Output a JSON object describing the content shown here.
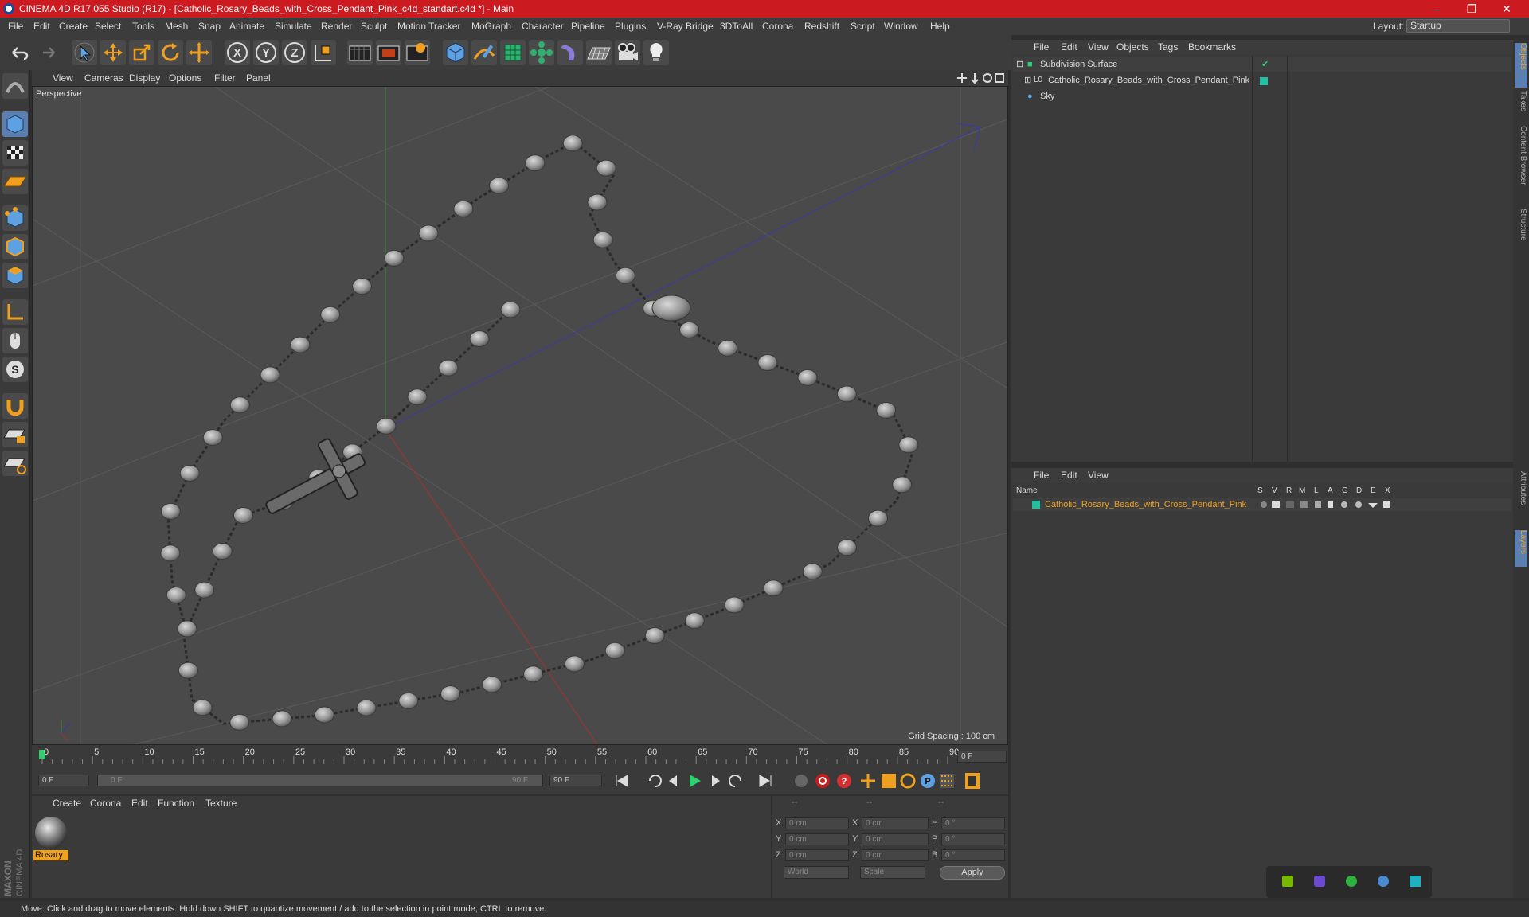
{
  "window": {
    "title": "CINEMA 4D R17.055 Studio (R17) - [Catholic_Rosary_Beads_with_Cross_Pendant_Pink_c4d_standart.c4d *] - Main",
    "minimize": "–",
    "maximize": "❐",
    "close": "✕"
  },
  "menubar": {
    "items": [
      "File",
      "Edit",
      "Create",
      "Select",
      "Tools",
      "Mesh",
      "Snap",
      "Animate",
      "Simulate",
      "Render",
      "Sculpt",
      "Motion Tracker",
      "MoGraph",
      "Character",
      "Pipeline",
      "Plugins",
      "V-Ray Bridge",
      "3DToAll",
      "Corona",
      "Redshift",
      "Script",
      "Window",
      "Help"
    ],
    "layout_label": "Layout:",
    "layout_value": "Startup"
  },
  "toolbar": {
    "icons": [
      "undo-icon",
      "redo-icon",
      "live-selection-icon",
      "move-icon",
      "scale-icon",
      "rotate-icon",
      "add-icon",
      "x-axis-lock-icon",
      "y-axis-lock-icon",
      "z-axis-lock-icon",
      "coordinate-system-icon",
      "render-view-icon",
      "render-picture-viewer-icon",
      "edit-render-settings-icon",
      "cube-icon",
      "pen-icon",
      "subdivision-icon",
      "cloner-icon",
      "deformer-icon",
      "floor-icon",
      "camera-icon",
      "light-icon"
    ]
  },
  "viewport": {
    "menu": [
      "View",
      "Cameras",
      "Display",
      "Options",
      "Filter",
      "Panel"
    ],
    "label": "Perspective",
    "grid_spacing": "Grid Spacing : 100 cm"
  },
  "timeline": {
    "ticks": [
      "0",
      "5",
      "10",
      "15",
      "20",
      "25",
      "30",
      "35",
      "40",
      "45",
      "50",
      "55",
      "60",
      "65",
      "70",
      "75",
      "80",
      "85",
      "90"
    ],
    "current_frame_right": "0 F",
    "start_field": "0 F",
    "slider_start": "0 F",
    "slider_end": "90 F",
    "end_field": "90 F"
  },
  "material_manager": {
    "menu": [
      "Create",
      "Corona",
      "Edit",
      "Function",
      "Texture"
    ],
    "material_name": "Rosary"
  },
  "coordinates": {
    "header_left": "--",
    "header_mid": "--",
    "header_right": "--",
    "rows": [
      {
        "axis": "X",
        "pos": "0 cm",
        "axis2": "X",
        "size": "0 cm",
        "axis3": "H",
        "rot": "0 °"
      },
      {
        "axis": "Y",
        "pos": "0 cm",
        "axis2": "Y",
        "size": "0 cm",
        "axis3": "P",
        "rot": "0 °"
      },
      {
        "axis": "Z",
        "pos": "0 cm",
        "axis2": "Z",
        "size": "0 cm",
        "axis3": "B",
        "rot": "0 °"
      }
    ],
    "mode1": "World",
    "mode2": "Scale",
    "apply": "Apply"
  },
  "object_manager": {
    "menu": [
      "File",
      "Edit",
      "View",
      "Objects",
      "Tags",
      "Bookmarks"
    ],
    "objects": [
      "Subdivision Surface",
      "Catholic_Rosary_Beads_with_Cross_Pendant_Pink",
      "Sky"
    ],
    "l0_badge": "L0"
  },
  "layer_manager": {
    "menu": [
      "File",
      "Edit",
      "View"
    ],
    "columns": [
      "Name",
      "S",
      "V",
      "R",
      "M",
      "L",
      "A",
      "G",
      "D",
      "E",
      "X"
    ],
    "layer_name": "Catholic_Rosary_Beads_with_Cross_Pendant_Pink"
  },
  "right_tabs": [
    "Objects",
    "Takes",
    "Content Browser",
    "Structure",
    "Attributes",
    "Layers"
  ],
  "maxon_logo": "MAXON CINEMA 4D",
  "status": "Move: Click and drag to move elements. Hold down SHIFT to quantize movement / add to the selection in point mode, CTRL to remove.",
  "colors": {
    "titlebar": "#cb1b21",
    "accent_orange": "#f0a020",
    "layer_teal": "#20c0a0"
  }
}
